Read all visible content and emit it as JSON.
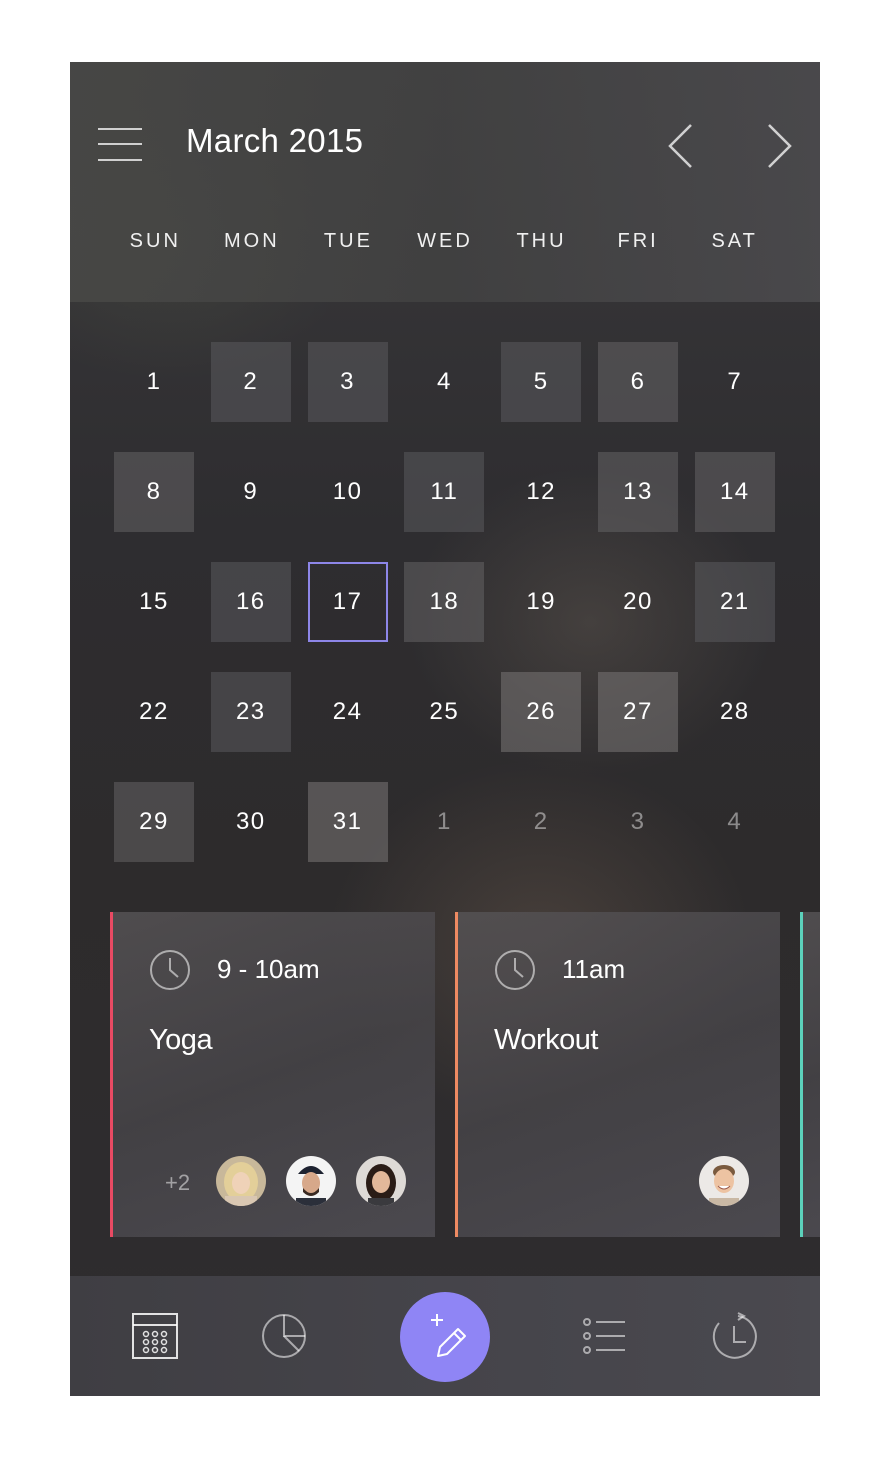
{
  "header": {
    "month_title": "March 2015",
    "weekdays": [
      "SUN",
      "MON",
      "TUE",
      "WED",
      "THU",
      "FRI",
      "SAT"
    ]
  },
  "calendar": {
    "selected_day": "17",
    "accent_color": "#8d86e8",
    "weeks": [
      [
        {
          "label": "1",
          "shade": 0
        },
        {
          "label": "2",
          "shade": 1
        },
        {
          "label": "3",
          "shade": 1
        },
        {
          "label": "4",
          "shade": 0
        },
        {
          "label": "5",
          "shade": 1
        },
        {
          "label": "6",
          "shade": 2
        },
        {
          "label": "7",
          "shade": 0
        }
      ],
      [
        {
          "label": "8",
          "shade": 2
        },
        {
          "label": "9",
          "shade": 0
        },
        {
          "label": "10",
          "shade": 0
        },
        {
          "label": "11",
          "shade": 1
        },
        {
          "label": "12",
          "shade": 0
        },
        {
          "label": "13",
          "shade": 2
        },
        {
          "label": "14",
          "shade": 2
        }
      ],
      [
        {
          "label": "15",
          "shade": 0
        },
        {
          "label": "16",
          "shade": 1
        },
        {
          "label": "17",
          "shade": 0,
          "today": true
        },
        {
          "label": "18",
          "shade": 2
        },
        {
          "label": "19",
          "shade": 0
        },
        {
          "label": "20",
          "shade": 0
        },
        {
          "label": "21",
          "shade": 1
        }
      ],
      [
        {
          "label": "22",
          "shade": 0
        },
        {
          "label": "23",
          "shade": 1
        },
        {
          "label": "24",
          "shade": 0
        },
        {
          "label": "25",
          "shade": 0
        },
        {
          "label": "26",
          "shade": 3
        },
        {
          "label": "27",
          "shade": 3
        },
        {
          "label": "28",
          "shade": 0
        }
      ],
      [
        {
          "label": "29",
          "shade": 2
        },
        {
          "label": "30",
          "shade": 0
        },
        {
          "label": "31",
          "shade": 3
        },
        {
          "label": "1",
          "shade": 0,
          "muted": true
        },
        {
          "label": "2",
          "shade": 0,
          "muted": true
        },
        {
          "label": "3",
          "shade": 0,
          "muted": true
        },
        {
          "label": "4",
          "shade": 0,
          "muted": true
        }
      ]
    ]
  },
  "events": [
    {
      "time": "9 - 10am",
      "title": "Yoga",
      "color": "#e84a63",
      "extra_count": "+2",
      "avatars": [
        "avatar-blonde-woman",
        "avatar-man-beanie",
        "avatar-smiling-woman"
      ]
    },
    {
      "time": "11am",
      "title": "Workout",
      "color": "#ee8a62",
      "avatars": [
        "avatar-smiling-man"
      ]
    },
    {
      "color": "#5cd1bb"
    }
  ],
  "tabbar": {
    "fab_color": "#8f85f5",
    "icons": [
      "calendar-grid-icon",
      "pie-chart-icon",
      "add-edit-icon",
      "list-icon",
      "history-icon"
    ]
  }
}
